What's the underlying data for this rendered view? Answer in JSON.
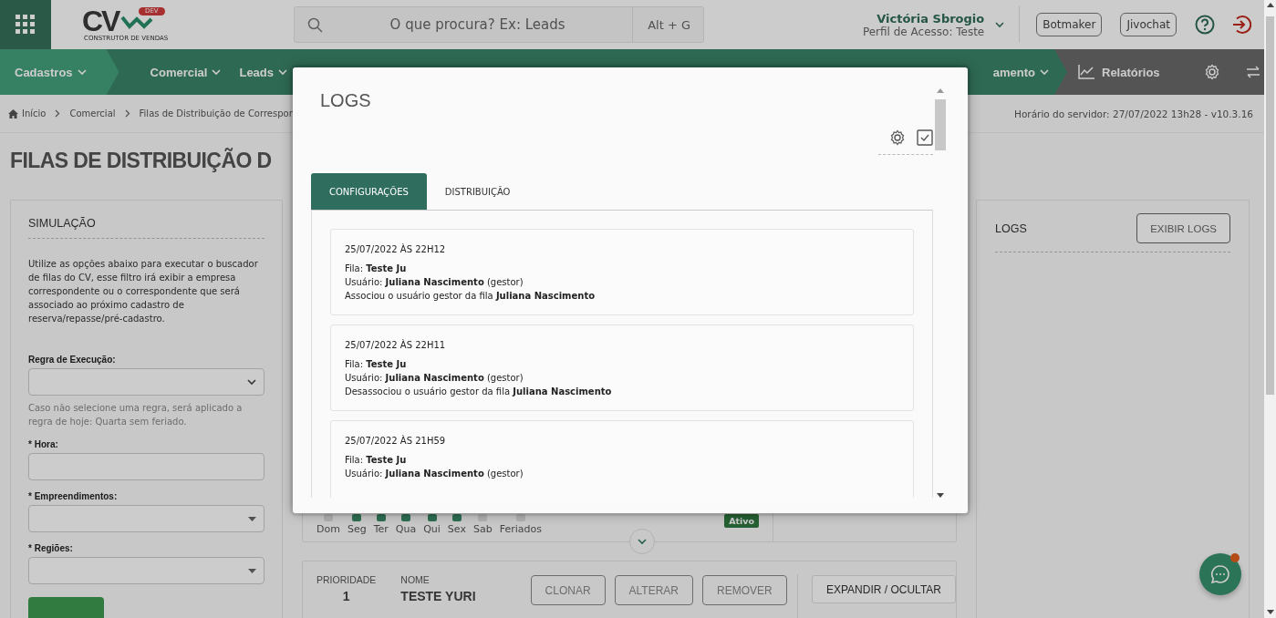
{
  "header": {
    "logo": {
      "text": "CV",
      "badge": "DEV",
      "tagline": "CONSTRUTOR DE VENDAS"
    },
    "search": {
      "placeholder": "O que procura? Ex: Leads",
      "shortcut": "Alt + G"
    },
    "user": {
      "name": "Victória Sbrogio",
      "profile": "Perfil de Acesso: Teste"
    },
    "buttons": [
      "Botmaker",
      "Jivochat"
    ]
  },
  "nav": {
    "items": [
      {
        "label": "Cadastros",
        "selected": true
      },
      {
        "label": "Comercial",
        "selected": false
      },
      {
        "label": "Leads",
        "selected": false
      }
    ],
    "cut_item": "amento",
    "reports": "Relatórios"
  },
  "breadcrumb": [
    "Início",
    "Comercial",
    "Filas de Distribuição de Correspor"
  ],
  "server_time": "Horário do servidor: 27/07/2022 13h28 - v10.3.16",
  "page_title": "FILAS DE DISTRIBUIÇÃO D",
  "simulation": {
    "title": "SIMULAÇÃO",
    "description": "Utilize as opções abaixo para executar o buscador de filas do CV, esse filtro irá exibir a empresa correspondente ou o correspondente que será associado ao próximo cadastro de reserva/repasse/pré-cadastro.",
    "fields": [
      {
        "kind": "select",
        "label": "Regra de Execução:",
        "hint": "Caso não selecione uma regra, será aplicado a regra de hoje: Quarta sem feriado."
      },
      {
        "kind": "input",
        "label": "* Hora:"
      },
      {
        "kind": "dropdown",
        "label": "* Empreendimentos:"
      },
      {
        "kind": "dropdown",
        "label": "* Regiões:"
      }
    ]
  },
  "queue_footer": {
    "days": [
      {
        "label": "Dom",
        "on": false
      },
      {
        "label": "Seg",
        "on": true
      },
      {
        "label": "Ter",
        "on": true
      },
      {
        "label": "Qua",
        "on": true
      },
      {
        "label": "Qui",
        "on": true
      },
      {
        "label": "Sex",
        "on": true
      },
      {
        "label": "Sab",
        "on": false
      },
      {
        "label": "Feriados",
        "on": false
      }
    ],
    "status": "Ativo"
  },
  "queue": {
    "priority_label": "PRIORIDADE",
    "priority": "1",
    "name_label": "NOME",
    "name": "TESTE YURI",
    "actions": [
      "CLONAR",
      "ALTERAR",
      "REMOVER"
    ],
    "toggle": "EXPANDIR / OCULTAR"
  },
  "logs_panel": {
    "title": "LOGS",
    "button": "EXIBIR LOGS"
  },
  "modal": {
    "title": "LOGS",
    "tabs": [
      {
        "label": "CONFIGURAÇÕES",
        "selected": true
      },
      {
        "label": "DISTRIBUIÇÃO",
        "selected": false
      }
    ],
    "entries": [
      {
        "date": "25/07/2022 ÀS 22H12",
        "lines": [
          "Fila: **Teste Ju**",
          "Usuário: **Juliana Nascimento** (gestor)",
          "Associou o usuário gestor da fila **Juliana Nascimento**"
        ]
      },
      {
        "date": "25/07/2022 ÀS 22H11",
        "lines": [
          "Fila: **Teste Ju**",
          "Usuário: **Juliana Nascimento** (gestor)",
          "Desassociou o usuário gestor da fila **Juliana Nascimento**"
        ]
      },
      {
        "date": "25/07/2022 ÀS 21H59",
        "lines": [
          "Fila: **Teste Ju**",
          "Usuário: **Juliana Nascimento** (gestor)"
        ]
      }
    ]
  }
}
